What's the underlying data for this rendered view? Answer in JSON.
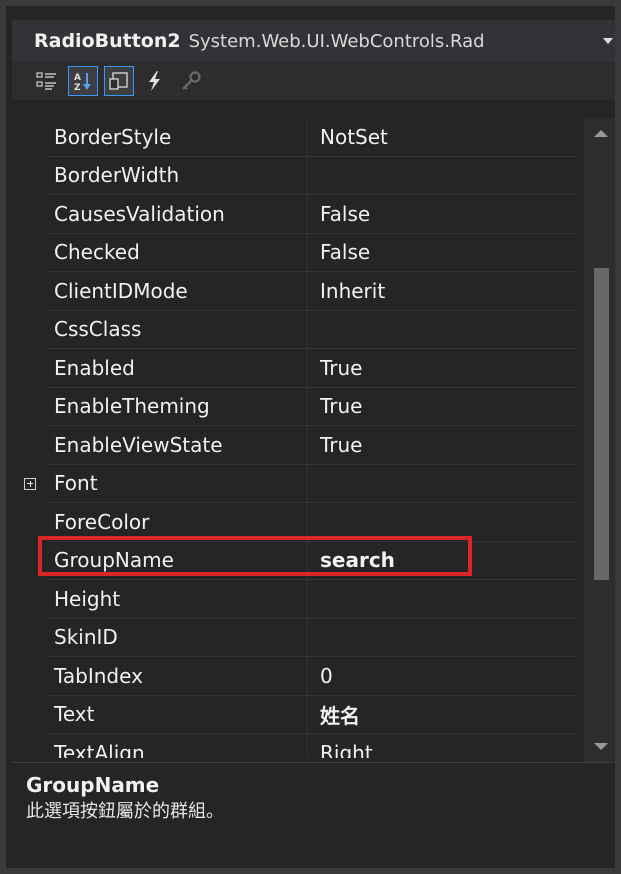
{
  "object_selector": {
    "name": "RadioButton2",
    "type": "System.Web.UI.WebControls.Rad"
  },
  "toolbar": {
    "buttons": [
      {
        "icon": "categorized-icon",
        "active": false
      },
      {
        "icon": "alphabetical-icon",
        "active": true
      },
      {
        "icon": "properties-icon",
        "active": true
      },
      {
        "icon": "events-lightning-icon",
        "active": false
      },
      {
        "icon": "property-pages-key-icon",
        "active": false
      }
    ]
  },
  "properties": [
    {
      "name": "BorderStyle",
      "value": "NotSet"
    },
    {
      "name": "BorderWidth",
      "value": ""
    },
    {
      "name": "CausesValidation",
      "value": "False"
    },
    {
      "name": "Checked",
      "value": "False"
    },
    {
      "name": "ClientIDMode",
      "value": "Inherit"
    },
    {
      "name": "CssClass",
      "value": ""
    },
    {
      "name": "Enabled",
      "value": "True"
    },
    {
      "name": "EnableTheming",
      "value": "True"
    },
    {
      "name": "EnableViewState",
      "value": "True"
    },
    {
      "name": "Font",
      "value": "",
      "expandable": true
    },
    {
      "name": "ForeColor",
      "value": ""
    },
    {
      "name": "GroupName",
      "value": "search",
      "bold": true,
      "highlighted": true
    },
    {
      "name": "Height",
      "value": ""
    },
    {
      "name": "SkinID",
      "value": ""
    },
    {
      "name": "TabIndex",
      "value": "0"
    },
    {
      "name": "Text",
      "value": "姓名",
      "bold": true
    },
    {
      "name": "TextAlign",
      "value": "Right"
    }
  ],
  "description": {
    "title": "GroupName",
    "text": "此選項按鈕屬於的群組。"
  },
  "colors": {
    "background": "#252526",
    "highlight_border": "#d9262b",
    "active_button_border": "#3399ff",
    "text": "#f1f1f1"
  }
}
